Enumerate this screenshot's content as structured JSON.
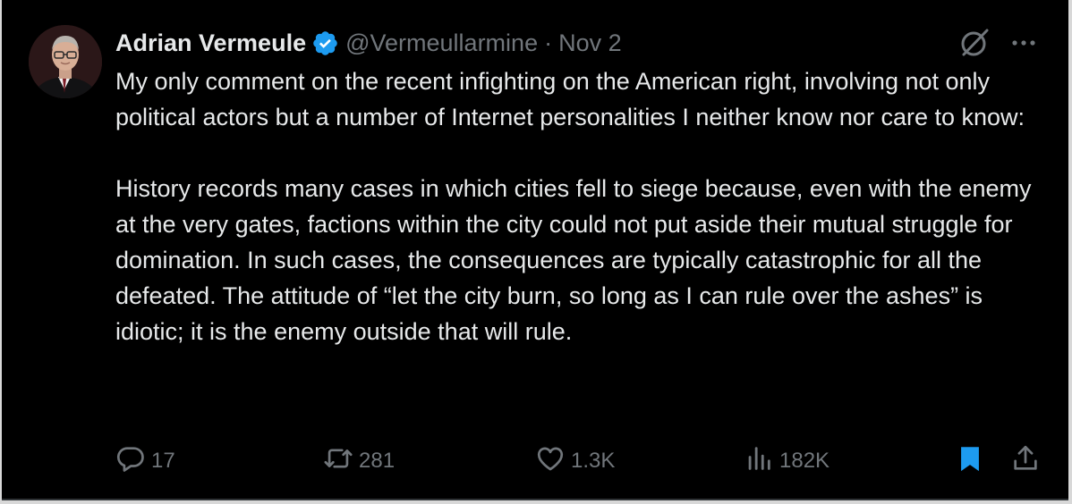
{
  "author": {
    "display_name": "Adrian Vermeule",
    "handle": "@Vermeullarmine",
    "separator": "·",
    "date": "Nov 2",
    "verified": true,
    "avatar": "avatar"
  },
  "tweet": {
    "paragraphs": [
      "My only comment on the recent infighting on the American right, involving not only political actors but a number of Internet personalities I neither know nor care to know:",
      "History records many cases in which cities fell to siege because, even with the enemy at the very gates, factions within the city could not put aside their mutual struggle for domination. In such cases, the consequences are typically catastrophic for all the defeated. The attitude of “let the city burn, so long as I can rule over the ashes” is idiotic; it is the enemy outside that will rule."
    ]
  },
  "actions": {
    "reply": {
      "icon": "reply-icon",
      "count": "17"
    },
    "repost": {
      "icon": "repost-icon",
      "count": "281"
    },
    "like": {
      "icon": "heart-icon",
      "count": "1.3K"
    },
    "views": {
      "icon": "views-icon",
      "count": "182K"
    },
    "bookmark": {
      "icon": "bookmark-icon",
      "active": true
    },
    "share": {
      "icon": "share-icon"
    }
  },
  "header_icons": [
    "grok-icon",
    "more-icon"
  ],
  "colors": {
    "background": "#000000",
    "text": "#e7e9ea",
    "secondary": "#71767b",
    "accent": "#1d9bf0"
  }
}
